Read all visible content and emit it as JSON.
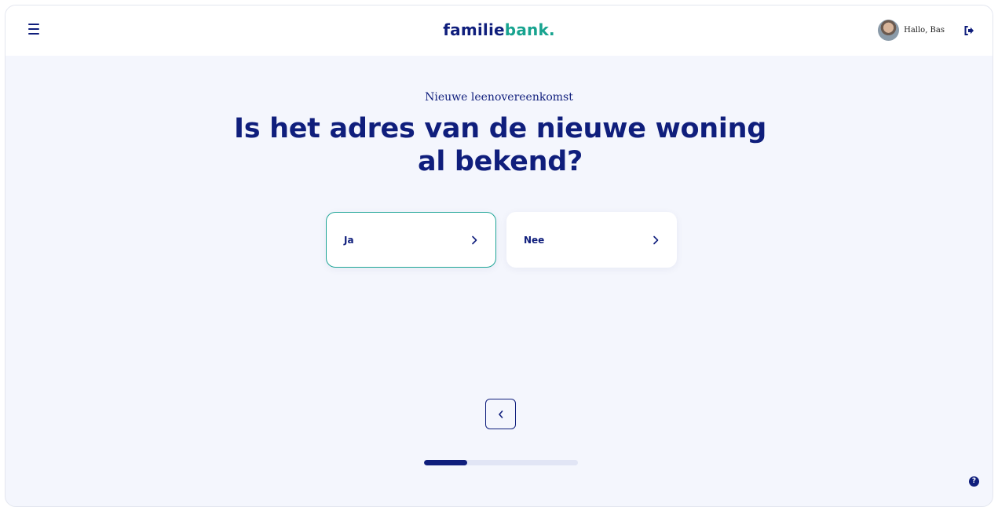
{
  "header": {
    "logo_part1": "familie",
    "logo_part2": "bank",
    "logo_part3": ".",
    "greeting": "Hallo, Bas",
    "menu_icon": "hamburger-icon",
    "logout_icon": "logout-icon"
  },
  "main": {
    "eyebrow": "Nieuwe leenovereenkomst",
    "question": "Is het adres van de nieuwe woning al bekend?",
    "options": [
      {
        "label": "Ja",
        "selected": true
      },
      {
        "label": "Nee",
        "selected": false
      }
    ],
    "back_icon": "chevron-left-icon"
  },
  "progress": {
    "fraction": 0.28
  },
  "help": {
    "label": "?"
  },
  "colors": {
    "brand_navy": "#0f1e7c",
    "brand_teal": "#17a38f",
    "page_bg": "#f4f6fd"
  }
}
